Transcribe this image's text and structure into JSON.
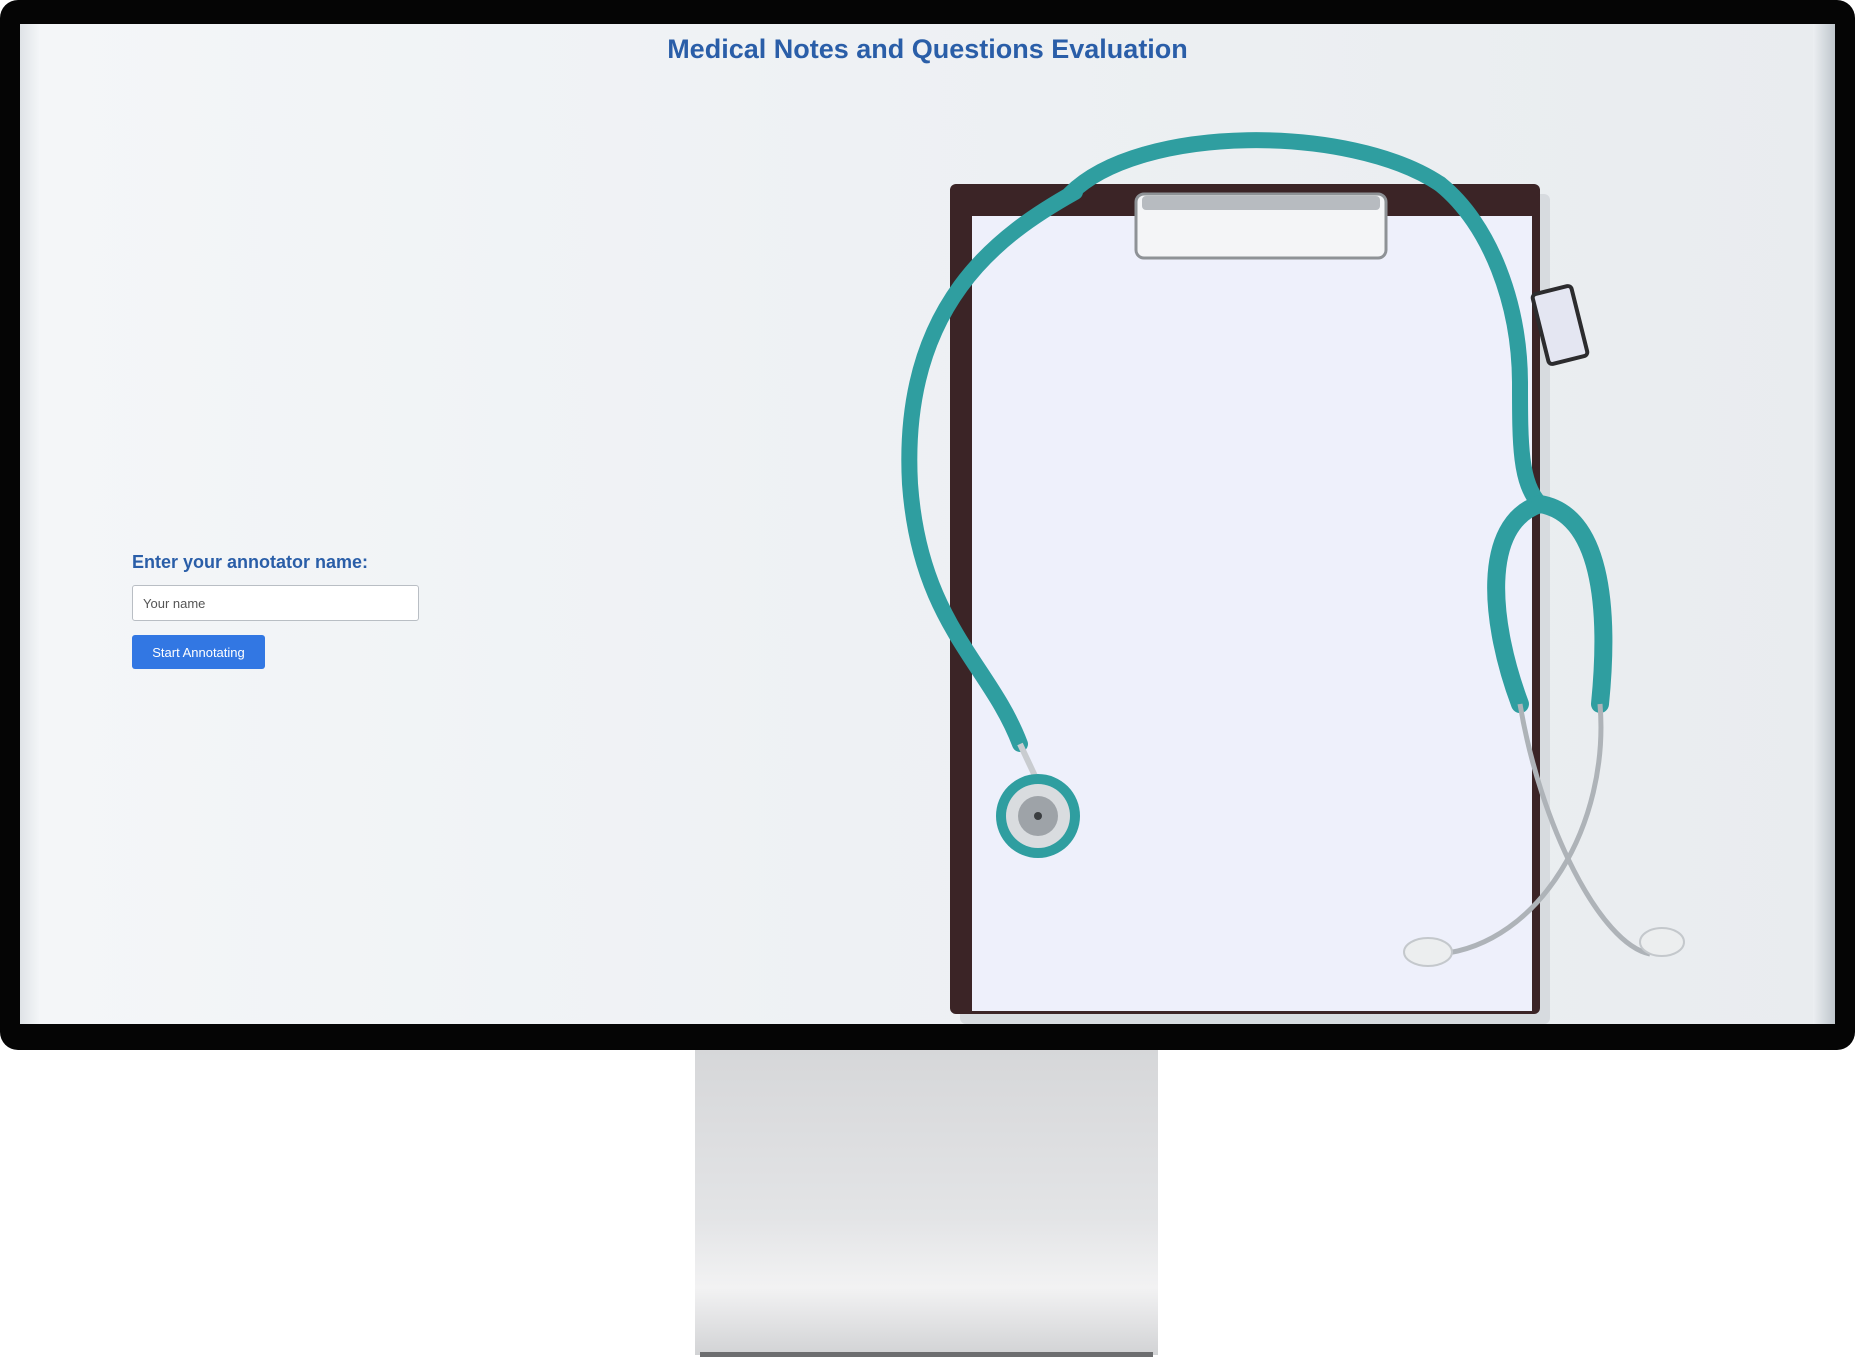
{
  "page": {
    "title": "Medical Notes and Questions Evaluation"
  },
  "form": {
    "label": "Enter your annotator name:",
    "name_placeholder": "Your name",
    "name_value": "",
    "start_button_label": "Start Annotating"
  },
  "illustration": {
    "subject": "stethoscope-on-clipboard",
    "stethoscope_color": "#2f9ea0",
    "clipboard_color": "#3b2426",
    "paper_color": "#eef0fb"
  },
  "colors": {
    "title": "#2a5ea8",
    "button": "#3277e3"
  }
}
